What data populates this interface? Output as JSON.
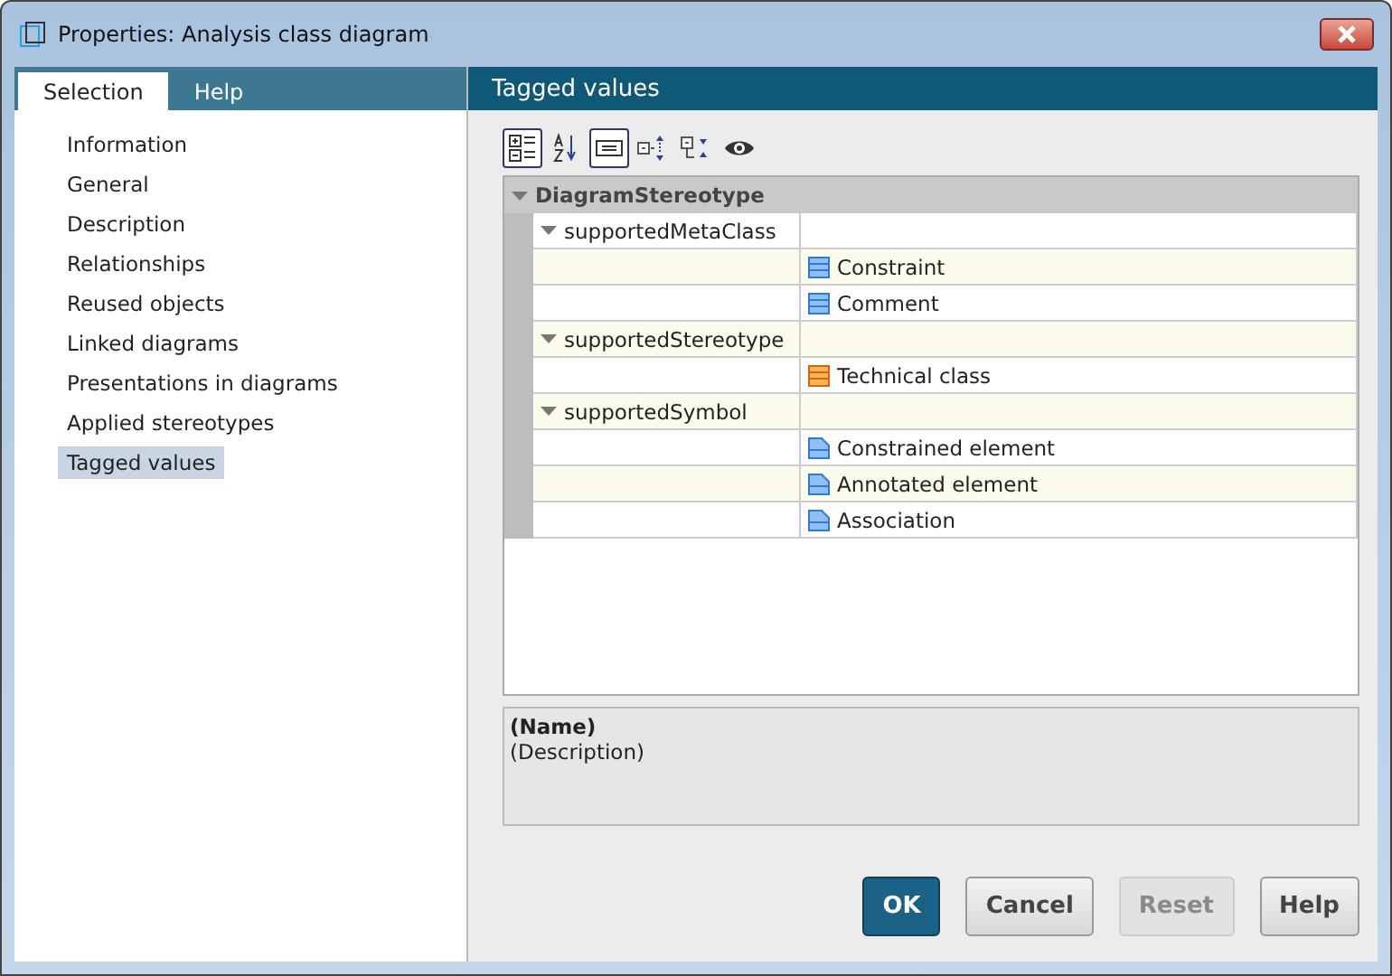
{
  "window": {
    "title": "Properties: Analysis class diagram"
  },
  "tabs": [
    {
      "label": "Selection",
      "selected": true
    },
    {
      "label": "Help",
      "selected": false
    }
  ],
  "sidebar": {
    "items": [
      {
        "label": "Information",
        "selected": false
      },
      {
        "label": "General",
        "selected": false
      },
      {
        "label": "Description",
        "selected": false
      },
      {
        "label": "Relationships",
        "selected": false
      },
      {
        "label": "Reused objects",
        "selected": false
      },
      {
        "label": "Linked diagrams",
        "selected": false
      },
      {
        "label": "Presentations in diagrams",
        "selected": false
      },
      {
        "label": "Applied stereotypes",
        "selected": false
      },
      {
        "label": "Tagged values",
        "selected": true
      }
    ]
  },
  "panel": {
    "title": "Tagged values"
  },
  "toolbar": [
    {
      "kind": "categorized",
      "selected": true
    },
    {
      "kind": "sort",
      "selected": false
    },
    {
      "kind": "description",
      "selected": true
    },
    {
      "kind": "expand",
      "selected": false
    },
    {
      "kind": "collapse",
      "selected": false
    },
    {
      "kind": "view",
      "selected": false
    }
  ],
  "tree": [
    {
      "label": "DiagramStereotype",
      "expanded": true,
      "children": [
        {
          "label": "supportedMetaClass",
          "expanded": true,
          "children": [
            {
              "label": "Constraint",
              "kind": "metaclass"
            },
            {
              "label": "Comment",
              "kind": "metaclass"
            }
          ]
        },
        {
          "label": "supportedStereotype",
          "expanded": true,
          "children": [
            {
              "label": "Technical class",
              "kind": "stereotype"
            }
          ]
        },
        {
          "label": "supportedSymbol",
          "expanded": true,
          "children": [
            {
              "label": "Constrained element",
              "kind": "symbol"
            },
            {
              "label": "Annotated element",
              "kind": "symbol"
            },
            {
              "label": "Association",
              "kind": "symbol"
            }
          ]
        }
      ]
    }
  ],
  "description": {
    "name": "(Name)",
    "text": "(Description)"
  },
  "buttons": [
    {
      "label": "OK",
      "kind": "default",
      "disabled": false
    },
    {
      "label": "Cancel",
      "kind": "normal",
      "disabled": false
    },
    {
      "label": "Reset",
      "kind": "normal",
      "disabled": true
    },
    {
      "label": "Help",
      "kind": "normal",
      "disabled": false
    }
  ]
}
